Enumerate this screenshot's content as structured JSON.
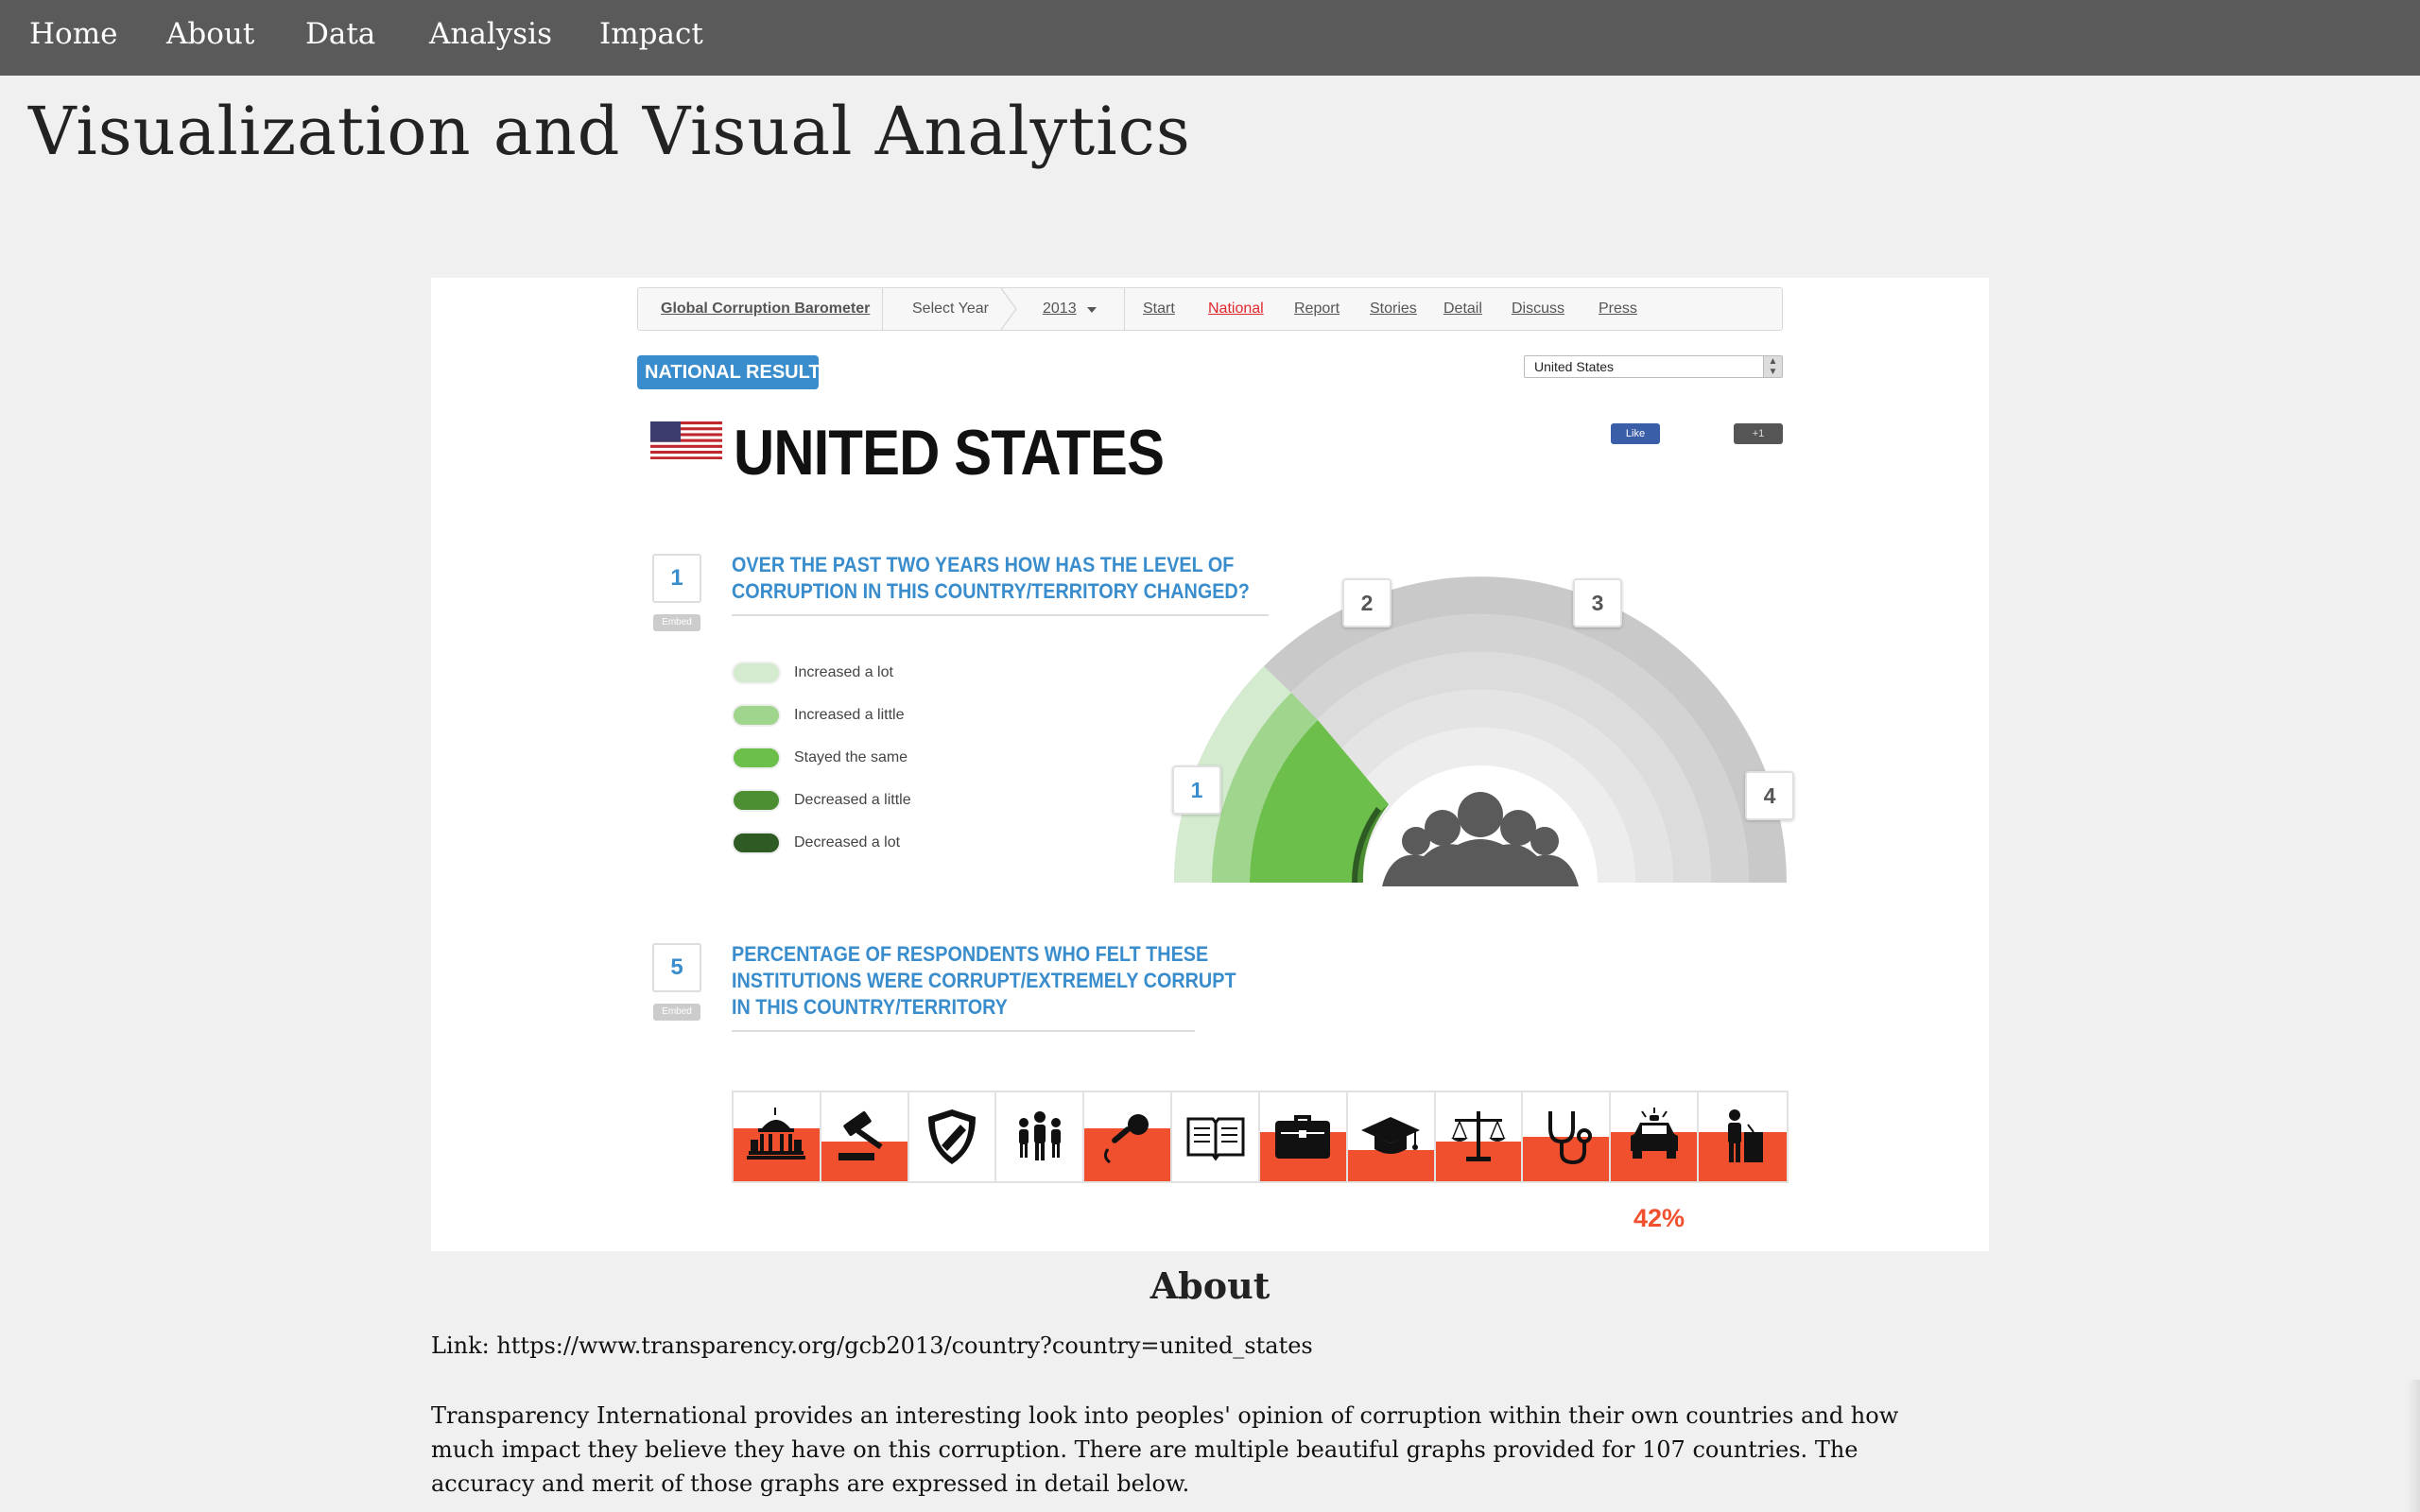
{
  "nav": {
    "items": [
      "Home",
      "About",
      "Data",
      "Analysis",
      "Impact"
    ]
  },
  "page": {
    "title": "Visualization and Visual Analytics"
  },
  "screenshot": {
    "toolbar": {
      "brand": "Global Corruption Barometer",
      "select_year_label": "Select Year",
      "year": "2013",
      "tabs": [
        "Start",
        "National",
        "Report",
        "Stories",
        "Detail",
        "Discuss",
        "Press"
      ],
      "active_tab": "National",
      "active_color": "#e0262b"
    },
    "badge": "NATIONAL RESULTS",
    "country_select": "United States",
    "country_name": "UNITED STATES",
    "flag_icon": "us-flag-icon",
    "social": {
      "like": "Like",
      "plus": "+1"
    },
    "question1": {
      "number": "1",
      "embed": "Embed",
      "text_line1": "OVER THE PAST TWO YEARS HOW HAS THE LEVEL OF",
      "text_line2": "CORRUPTION IN THIS COUNTRY/TERRITORY CHANGED?",
      "legend": [
        {
          "label": "Increased a lot",
          "color": "#d4ebcf"
        },
        {
          "label": "Increased a little",
          "color": "#9fd58c"
        },
        {
          "label": "Stayed the same",
          "color": "#6cbf4a"
        },
        {
          "label": "Decreased a little",
          "color": "#4c8f33"
        },
        {
          "label": "Decreased a lot",
          "color": "#2e5a23"
        }
      ],
      "chart_markers": [
        "1",
        "2",
        "3",
        "4"
      ],
      "people_icon": "people-group-icon"
    },
    "question5": {
      "number": "5",
      "embed": "Embed",
      "text_line1": "PERCENTAGE OF RESPONDENTS WHO FELT THESE",
      "text_line2": "INSTITUTIONS WERE CORRUPT/EXTREMELY CORRUPT",
      "text_line3": "IN THIS COUNTRY/TERRITORY",
      "fill_color": "#f1502f",
      "institutions": [
        {
          "icon": "parliament-icon",
          "fill": 0.6
        },
        {
          "icon": "gavel-icon",
          "fill": 0.45
        },
        {
          "icon": "shield-icon",
          "fill": 0.0
        },
        {
          "icon": "people-icon",
          "fill": 0.0
        },
        {
          "icon": "microphone-icon",
          "fill": 0.6
        },
        {
          "icon": "book-icon",
          "fill": 0.0
        },
        {
          "icon": "briefcase-icon",
          "fill": 0.55
        },
        {
          "icon": "graduation-cap-icon",
          "fill": 0.35
        },
        {
          "icon": "scales-icon",
          "fill": 0.45
        },
        {
          "icon": "stethoscope-icon",
          "fill": 0.5
        },
        {
          "icon": "police-car-icon",
          "fill": 0.55
        },
        {
          "icon": "speaker-podium-icon",
          "fill": 0.55
        }
      ],
      "highlight_value": "42%"
    }
  },
  "about": {
    "heading": "About",
    "link_line": "Link: https://www.transparency.org/gcb2013/country?country=united_states",
    "paragraph": "Transparency International provides an interesting look into peoples' opinion of corruption within their own countries and how much impact they believe they have on this corruption. There are multiple beautiful graphs provided for 107 countries. The accuracy and merit of those graphs are expressed in detail below."
  }
}
